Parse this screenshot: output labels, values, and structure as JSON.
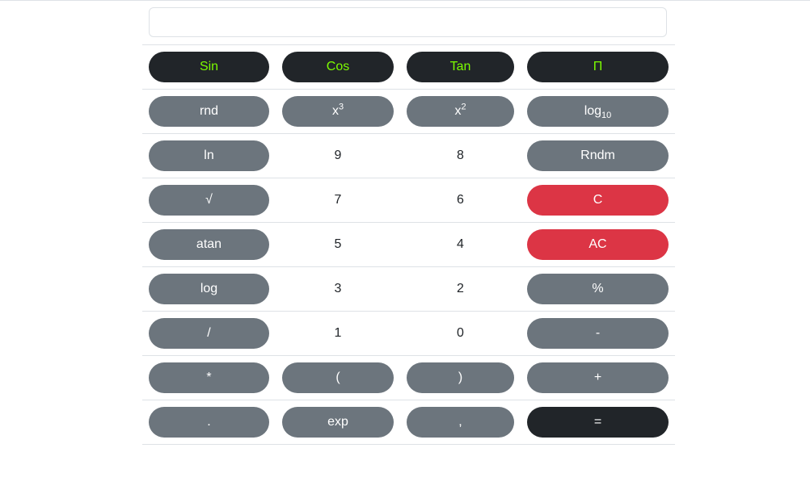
{
  "display": {
    "value": "",
    "placeholder": ""
  },
  "buttons": {
    "sin": "Sin",
    "cos": "Cos",
    "tan": "Tan",
    "pi": "Π",
    "rnd": "rnd",
    "cube_base": "x",
    "cube_exp": "3",
    "square_base": "x",
    "square_exp": "2",
    "log10_base": "log",
    "log10_sub": "10",
    "ln": "ln",
    "nine": "9",
    "eight": "8",
    "rndm": "Rndm",
    "sqrt": "√",
    "seven": "7",
    "six": "6",
    "clear": "C",
    "atan": "atan",
    "five": "5",
    "four": "4",
    "all_clear": "AC",
    "log": "log",
    "three": "3",
    "two": "2",
    "percent": "%",
    "divide": "/",
    "one": "1",
    "zero": "0",
    "minus": "-",
    "multiply": "*",
    "open_paren": "(",
    "close_paren": ")",
    "plus": "+",
    "decimal": ".",
    "exp": "exp",
    "comma": ",",
    "equals": "="
  },
  "colors": {
    "dark": "#212529",
    "gray": "#6c757d",
    "red": "#dc3545",
    "trig_text": "#7cfc00"
  }
}
